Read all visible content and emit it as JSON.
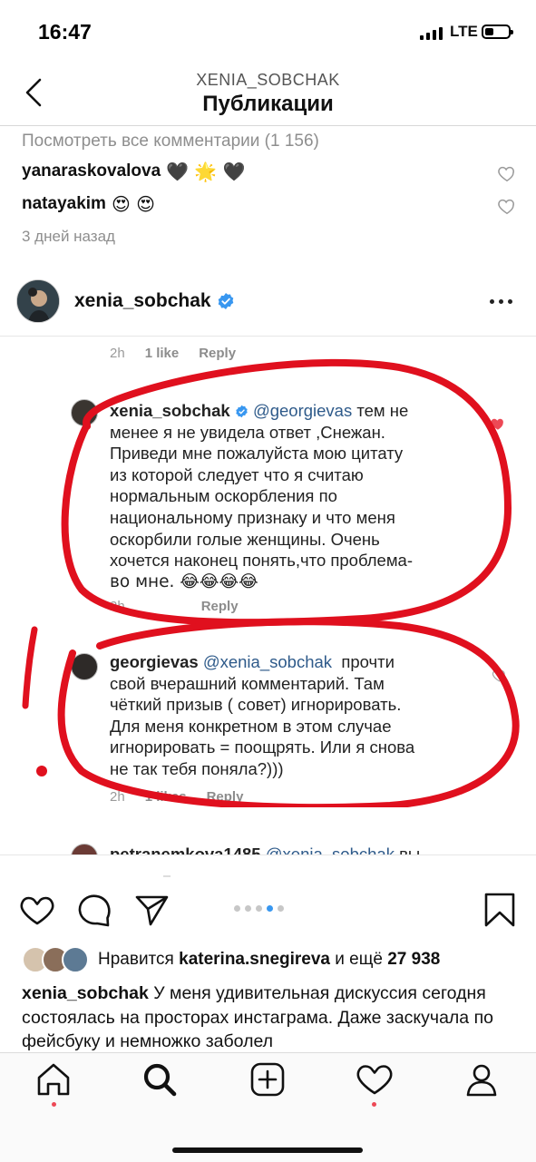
{
  "status_bar": {
    "time": "16:47",
    "network": "LTE"
  },
  "header": {
    "account": "XENIA_SOBCHAK",
    "title": "Публикации"
  },
  "prev_post": {
    "view_all": "Посмотреть все комментарии (1 156)",
    "comments": [
      {
        "user": "yanaraskovalova",
        "emoji": "🖤 🌟 🖤"
      },
      {
        "user": "natayakim",
        "emoji": "😍 😍"
      }
    ],
    "time_ago": "3 дней назад"
  },
  "post": {
    "username": "xenia_sobchak",
    "verified": true
  },
  "thread": {
    "top_meta": {
      "time": "2h",
      "likes": "1 like",
      "reply": "Reply"
    },
    "comment1": {
      "user": "xenia_sobchak",
      "mention": "@georgievas",
      "lines": [
        "тем не",
        "менее я не увидела ответ ,Снежан.",
        "Приведи мне пожалуйста мою цитату",
        "из которой следует что я считаю",
        "нормальным оскорбления по",
        "национальному признаку и что меня",
        "оскорбили голые женщины. Очень",
        "хочется наконец понять,что проблема-",
        "во мне. 😂😂😂😂"
      ],
      "meta": {
        "time": "2h",
        "reply": "Reply"
      }
    },
    "comment2": {
      "user": "georgievas",
      "mention": "@xenia_sobchak",
      "lines": [
        "прочти",
        "свой вчерашний комментарий. Там",
        "чёткий призыв ( совет) игнорировать.",
        "Для меня конкретном в этом случае",
        "игнорировать = поощрять.  Или я снова",
        "не так тебя поняла?)))"
      ],
      "meta": {
        "time": "2h",
        "likes": "1 likes",
        "reply": "Reply"
      }
    },
    "comment3": {
      "user": "petranemkova1485",
      "mention": "@xenia_sobchak",
      "tail": "вы"
    }
  },
  "carousel": {
    "count": 5,
    "active_index": 3
  },
  "likes": {
    "prefix": "Нравится",
    "user": "katerina.snegireva",
    "middle": "и ещё",
    "count": "27 938"
  },
  "caption": {
    "user": "xenia_sobchak",
    "text": "У меня удивительная дискуссия сегодня состоялась на просторах инстаграма. Даже заскучала по фейсбуку и немножко заболел"
  },
  "icons": {
    "back": "chevron-left-icon",
    "heart": "heart-icon",
    "comment": "comment-icon",
    "share": "paper-plane-icon",
    "save": "bookmark-icon",
    "home": "home-icon",
    "search": "search-icon",
    "add": "plus-square-icon",
    "activity": "heart-icon",
    "profile": "profile-icon"
  },
  "colors": {
    "accent": "#3897f0",
    "like_red": "#ed4956",
    "scribble_red": "#e0101e",
    "muted": "#8e8e8e"
  }
}
